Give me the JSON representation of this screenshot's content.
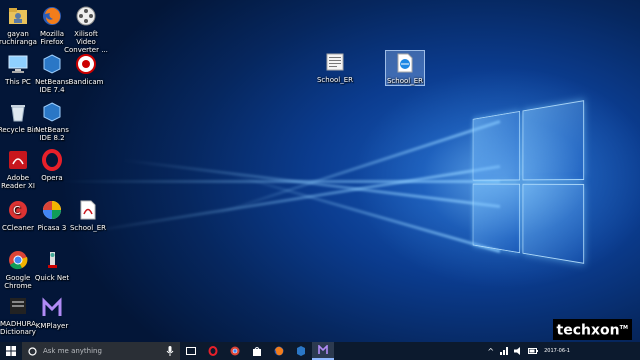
{
  "desktop_icons": [
    {
      "id": "gayan",
      "label": "gayan ruchiranga",
      "icon": "user-folder-icon"
    },
    {
      "id": "firefox",
      "label": "Mozilla Firefox",
      "icon": "firefox-icon"
    },
    {
      "id": "xilisoft",
      "label": "Xilisoft Video Converter ...",
      "icon": "film-reel-icon"
    },
    {
      "id": "thispc",
      "label": "This PC",
      "icon": "computer-icon"
    },
    {
      "id": "netbeans74",
      "label": "NetBeans IDE 7.4",
      "icon": "netbeans-icon"
    },
    {
      "id": "bandicam",
      "label": "Bandicam",
      "icon": "bandicam-icon"
    },
    {
      "id": "recycle",
      "label": "Recycle Bin",
      "icon": "recycle-bin-icon"
    },
    {
      "id": "netbeans82",
      "label": "NetBeans IDE 8.2",
      "icon": "netbeans-icon"
    },
    {
      "id": "adobe",
      "label": "Adobe Reader XI",
      "icon": "pdf-icon"
    },
    {
      "id": "opera",
      "label": "Opera",
      "icon": "opera-icon"
    },
    {
      "id": "ccleaner",
      "label": "CCleaner",
      "icon": "ccleaner-icon"
    },
    {
      "id": "picasa",
      "label": "Picasa 3",
      "icon": "picasa-icon"
    },
    {
      "id": "school_pdf",
      "label": "School_ER",
      "icon": "pdf-icon"
    },
    {
      "id": "chrome",
      "label": "Google Chrome",
      "icon": "chrome-icon"
    },
    {
      "id": "quicknet",
      "label": "Quick Net",
      "icon": "quicknet-icon"
    },
    {
      "id": "madhura",
      "label": "MADHURA Dictionary",
      "icon": "dictionary-icon"
    },
    {
      "id": "kmplayer",
      "label": "KMPlayer",
      "icon": "kmplayer-icon"
    },
    {
      "id": "school_doc",
      "label": "School_ER",
      "icon": "document-icon"
    },
    {
      "id": "school_html",
      "label": "School_ER",
      "icon": "html-file-icon"
    }
  ],
  "taskbar": {
    "search_placeholder": "Ask me anything",
    "pinned": [
      "cortana-mic-icon",
      "task-view-icon",
      "opera-icon",
      "chrome-icon",
      "store-icon",
      "firefox-icon",
      "netbeans-icon",
      "kmplayer-icon"
    ],
    "tray_time": "2017-06-1",
    "watermark": "techxon",
    "watermark_tm": "TM"
  },
  "colors": {
    "accent": "#1a5fc2",
    "taskbar": "#0c1a2e",
    "search": "#2a2f36"
  }
}
